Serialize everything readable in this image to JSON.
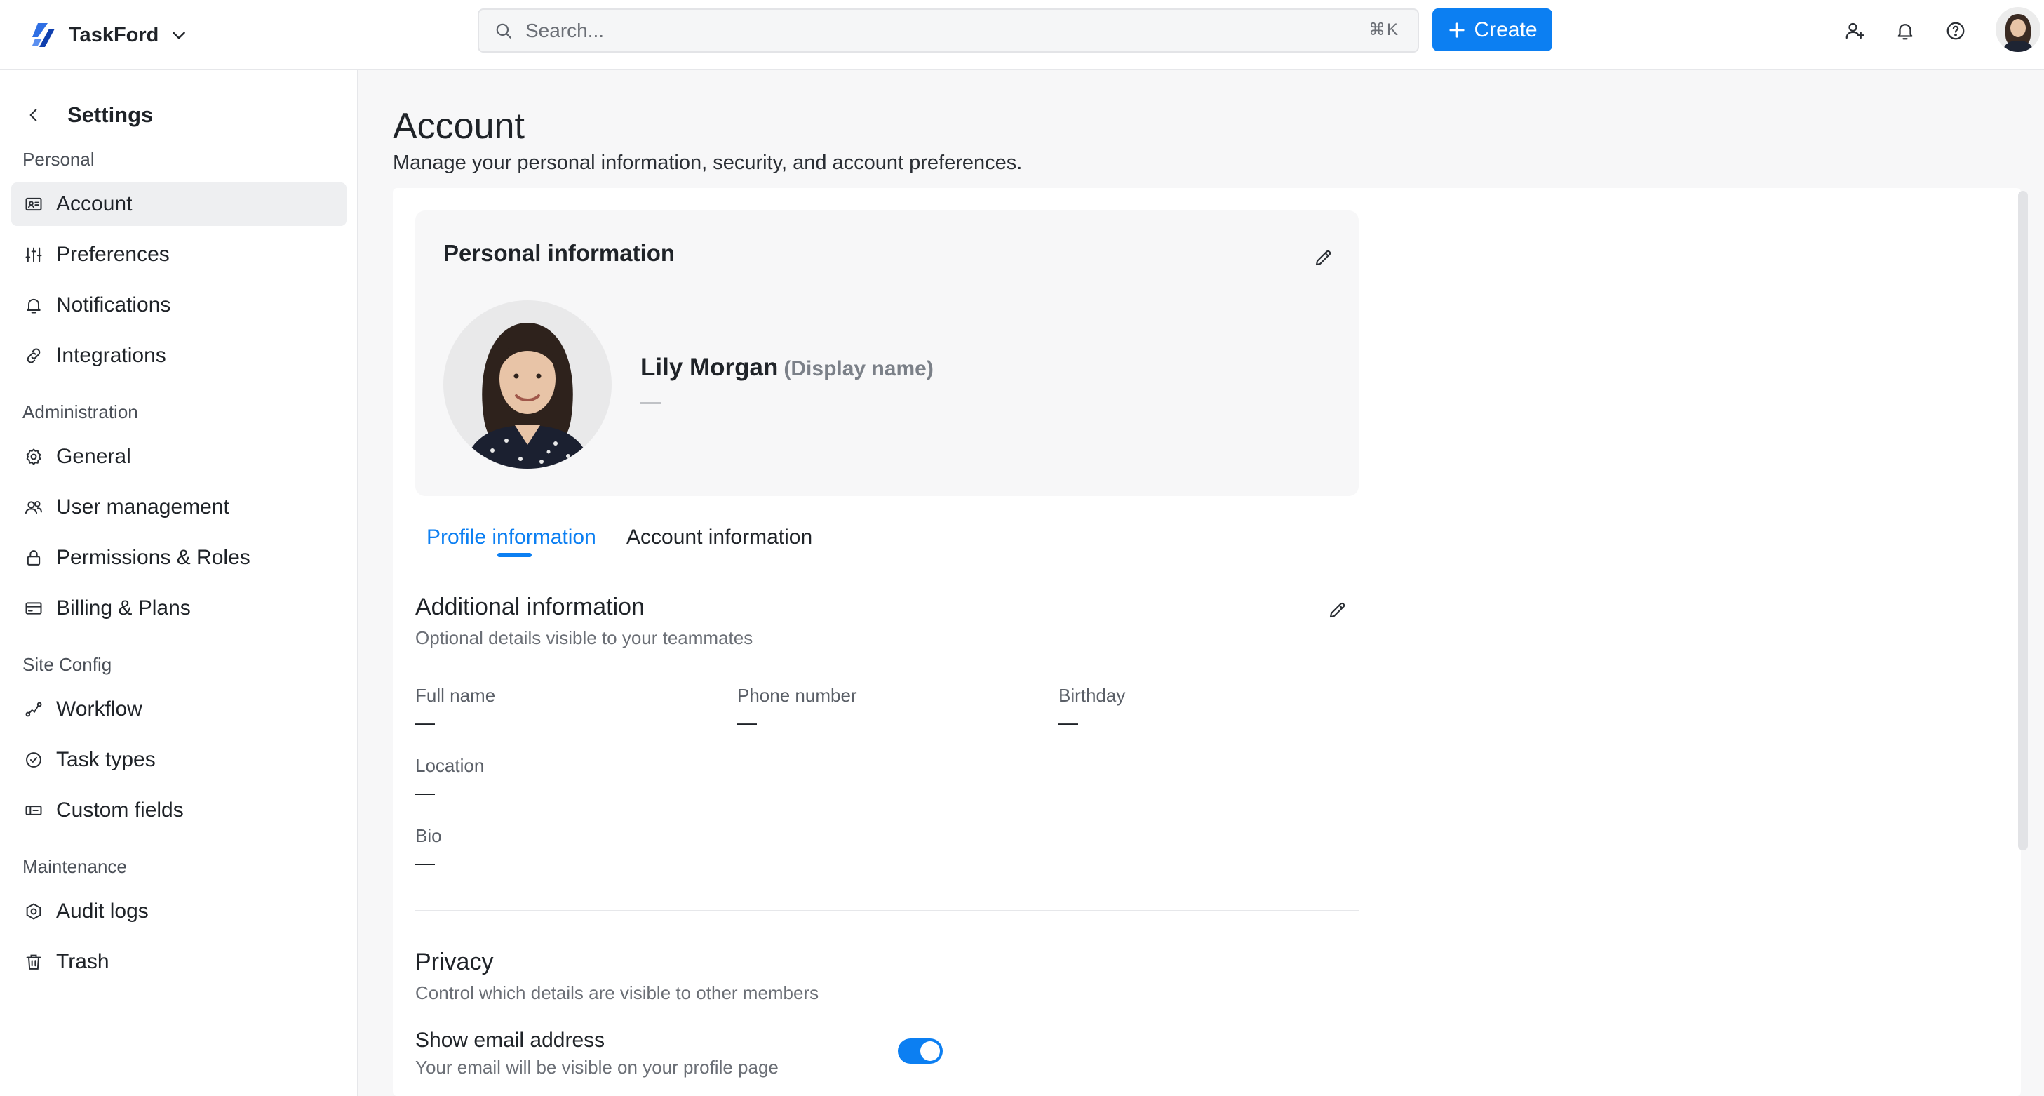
{
  "app": {
    "name": "TaskFord",
    "brand_color": "#0c7ff2"
  },
  "header": {
    "search_placeholder": "Search...",
    "search_shortcut": "⌘K",
    "create_label": "Create",
    "icons": [
      "invite-user-icon",
      "bell-icon",
      "help-icon"
    ]
  },
  "sidebar": {
    "title": "Settings",
    "sections": [
      {
        "label": "Personal",
        "items": [
          {
            "label": "Account",
            "icon": "id-card-icon",
            "active": true
          },
          {
            "label": "Preferences",
            "icon": "sliders-icon"
          },
          {
            "label": "Notifications",
            "icon": "bell-icon"
          },
          {
            "label": "Integrations",
            "icon": "link-icon"
          }
        ]
      },
      {
        "label": "Administration",
        "items": [
          {
            "label": "General",
            "icon": "gear-icon"
          },
          {
            "label": "User management",
            "icon": "users-icon"
          },
          {
            "label": "Permissions & Roles",
            "icon": "lock-icon"
          },
          {
            "label": "Billing & Plans",
            "icon": "credit-card-icon"
          }
        ]
      },
      {
        "label": "Site Config",
        "items": [
          {
            "label": "Workflow",
            "icon": "workflow-icon"
          },
          {
            "label": "Task types",
            "icon": "check-circle-icon"
          },
          {
            "label": "Custom fields",
            "icon": "custom-fields-icon"
          }
        ]
      },
      {
        "label": "Maintenance",
        "items": [
          {
            "label": "Audit logs",
            "icon": "shield-icon"
          },
          {
            "label": "Trash",
            "icon": "trash-icon"
          }
        ]
      }
    ]
  },
  "main": {
    "title": "Account",
    "subtitle": "Manage your personal information, security, and account preferences.",
    "personal_info": {
      "title": "Personal information",
      "display_name": "Lily Morgan",
      "display_name_hint": "(Display name)",
      "secondary": "—"
    },
    "tabs": [
      {
        "label": "Profile information",
        "active": true
      },
      {
        "label": "Account information"
      }
    ],
    "additional_info": {
      "title": "Additional information",
      "description": "Optional details visible to your teammates",
      "fields": [
        {
          "label": "Full name",
          "value": "—"
        },
        {
          "label": "Phone number",
          "value": "—"
        },
        {
          "label": "Birthday",
          "value": "—"
        },
        {
          "label": "Location",
          "value": "—"
        },
        {
          "label": "Bio",
          "value": "—"
        }
      ]
    },
    "privacy": {
      "title": "Privacy",
      "description": "Control which details are visible to other members",
      "settings": [
        {
          "label": "Show email address",
          "description": "Your email will be visible on your profile page",
          "enabled": true
        }
      ]
    }
  }
}
